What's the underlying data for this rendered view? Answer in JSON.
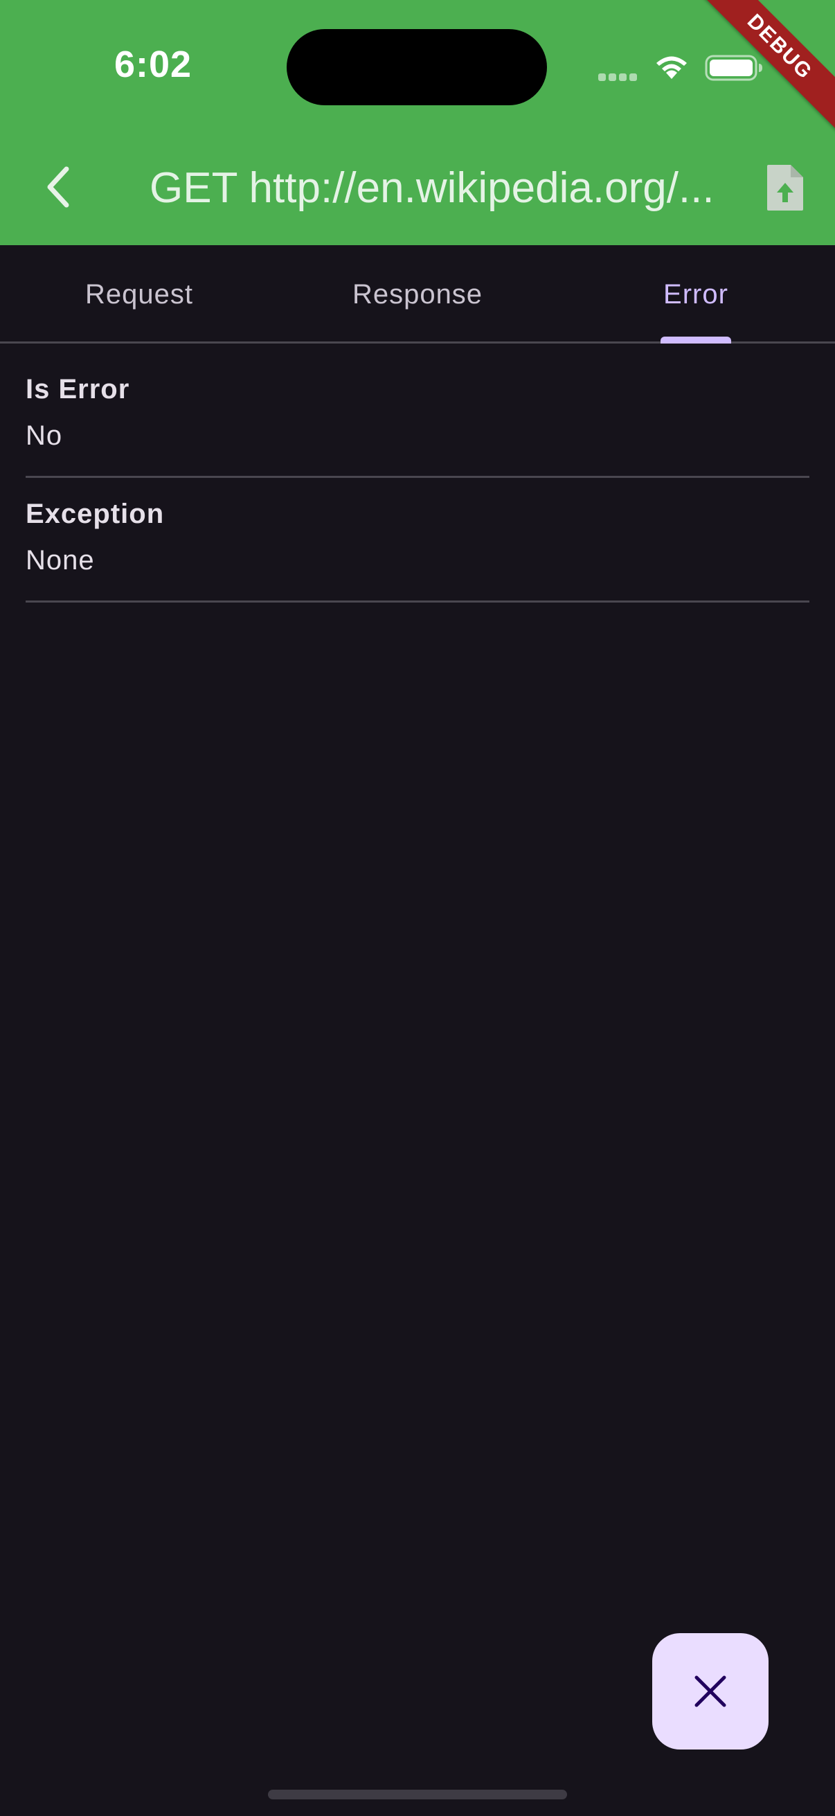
{
  "status_bar": {
    "time": "6:02"
  },
  "debug_banner": "DEBUG",
  "app_bar": {
    "title": "GET http://en.wikipedia.org/...",
    "back_icon": "chevron-left-icon",
    "share_icon": "file-upload-icon"
  },
  "tabs": [
    {
      "label": "Request",
      "active": false
    },
    {
      "label": "Response",
      "active": false
    },
    {
      "label": "Error",
      "active": true
    }
  ],
  "error_tab": {
    "fields": [
      {
        "label": "Is Error",
        "value": "No"
      },
      {
        "label": "Exception",
        "value": "None"
      }
    ]
  },
  "fab": {
    "icon": "close-icon"
  },
  "colors": {
    "app_bar": "#4caf50",
    "background": "#16131b",
    "accent": "#d0bcff",
    "fab": "#eaddff",
    "debug_banner": "#a0201f"
  }
}
